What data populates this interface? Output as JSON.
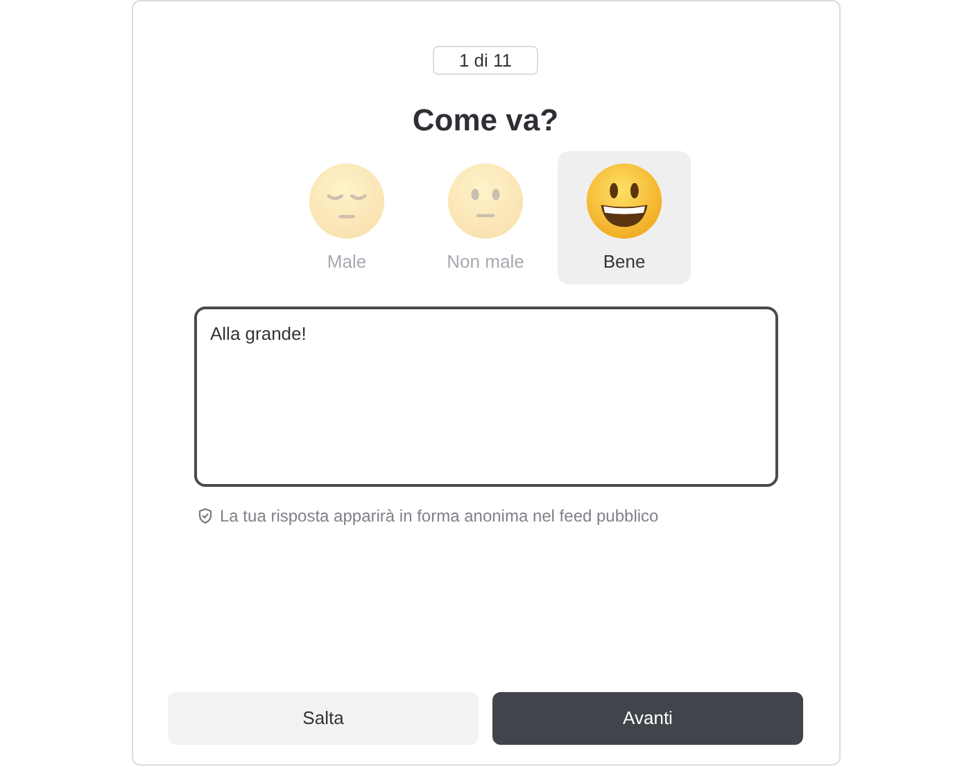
{
  "counter": "1 di 11",
  "title": "Come va?",
  "moods": [
    {
      "kind": "sad",
      "label": "Male",
      "selected": false
    },
    {
      "kind": "neutral",
      "label": "Non male",
      "selected": false
    },
    {
      "kind": "happy",
      "label": "Bene",
      "selected": true
    }
  ],
  "answer": {
    "value": "Alla grande!"
  },
  "privacy_note": "La tua risposta apparirà in forma anonima nel feed pubblico",
  "buttons": [
    {
      "kind": "secondary",
      "label": "Salta"
    },
    {
      "kind": "primary",
      "label": "Avanti"
    }
  ]
}
